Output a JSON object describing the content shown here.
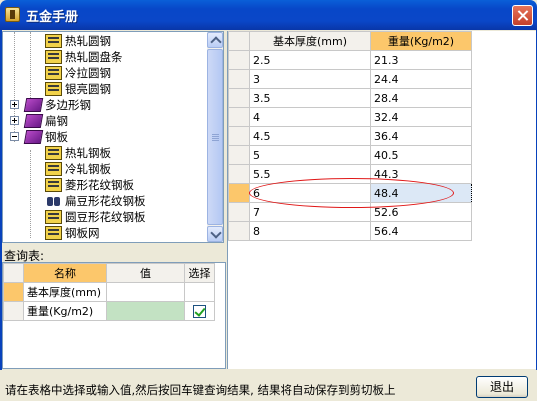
{
  "window": {
    "title": "五金手册"
  },
  "tree": {
    "items": [
      {
        "label": "热轧圆钢",
        "icon": "book-icon",
        "level": 2
      },
      {
        "label": "热轧圆盘条",
        "icon": "book-icon",
        "level": 2
      },
      {
        "label": "冷拉圆钢",
        "icon": "book-icon",
        "level": 2
      },
      {
        "label": "银亮圆钢",
        "icon": "book-icon",
        "level": 2
      },
      {
        "label": "多边形钢",
        "icon": "folder-icon",
        "level": 1,
        "expander": "plus"
      },
      {
        "label": "扁钢",
        "icon": "folder-icon",
        "level": 1,
        "expander": "plus"
      },
      {
        "label": "钢板",
        "icon": "folder-icon",
        "level": 1,
        "expander": "minus"
      },
      {
        "label": "热轧钢板",
        "icon": "book-icon",
        "level": 2
      },
      {
        "label": "冷轧钢板",
        "icon": "book-icon",
        "level": 2
      },
      {
        "label": "菱形花纹钢板",
        "icon": "book-icon",
        "level": 2
      },
      {
        "label": "扁豆形花纹钢板",
        "icon": "binoculars-icon",
        "level": 2,
        "selected": true
      },
      {
        "label": "圆豆形花纹钢板",
        "icon": "book-icon",
        "level": 2
      },
      {
        "label": "钢板网",
        "icon": "book-icon",
        "level": 2
      }
    ]
  },
  "query": {
    "label": "查询表:",
    "headers": {
      "name": "名称",
      "value": "值",
      "select": "选择"
    },
    "rows": [
      {
        "name": "基本厚度(mm)",
        "value": "",
        "selected": false
      },
      {
        "name": "重量(Kg/m2)",
        "value": "",
        "selected": true
      }
    ]
  },
  "result": {
    "headers": {
      "thickness": "基本厚度(mm)",
      "weight": "重量(Kg/m2)"
    },
    "rows": [
      {
        "thickness": "2.5",
        "weight": "21.3"
      },
      {
        "thickness": "3",
        "weight": "24.4"
      },
      {
        "thickness": "3.5",
        "weight": "28.4"
      },
      {
        "thickness": "4",
        "weight": "32.4"
      },
      {
        "thickness": "4.5",
        "weight": "36.4"
      },
      {
        "thickness": "5",
        "weight": "40.5"
      },
      {
        "thickness": "5.5",
        "weight": "44.3"
      },
      {
        "thickness": "6",
        "weight": "48.4",
        "selected": true
      },
      {
        "thickness": "7",
        "weight": "52.6"
      },
      {
        "thickness": "8",
        "weight": "56.4"
      }
    ]
  },
  "status": {
    "text": "请在表格中选择或输入值,然后按回车键查询结果, 结果将自动保存到剪切板上"
  },
  "buttons": {
    "exit": "退出"
  },
  "colors": {
    "title_bar": "#0a47c8",
    "header_selected": "#fcc76b",
    "value_green": "#c3e2c3",
    "highlight": "#e01818"
  }
}
